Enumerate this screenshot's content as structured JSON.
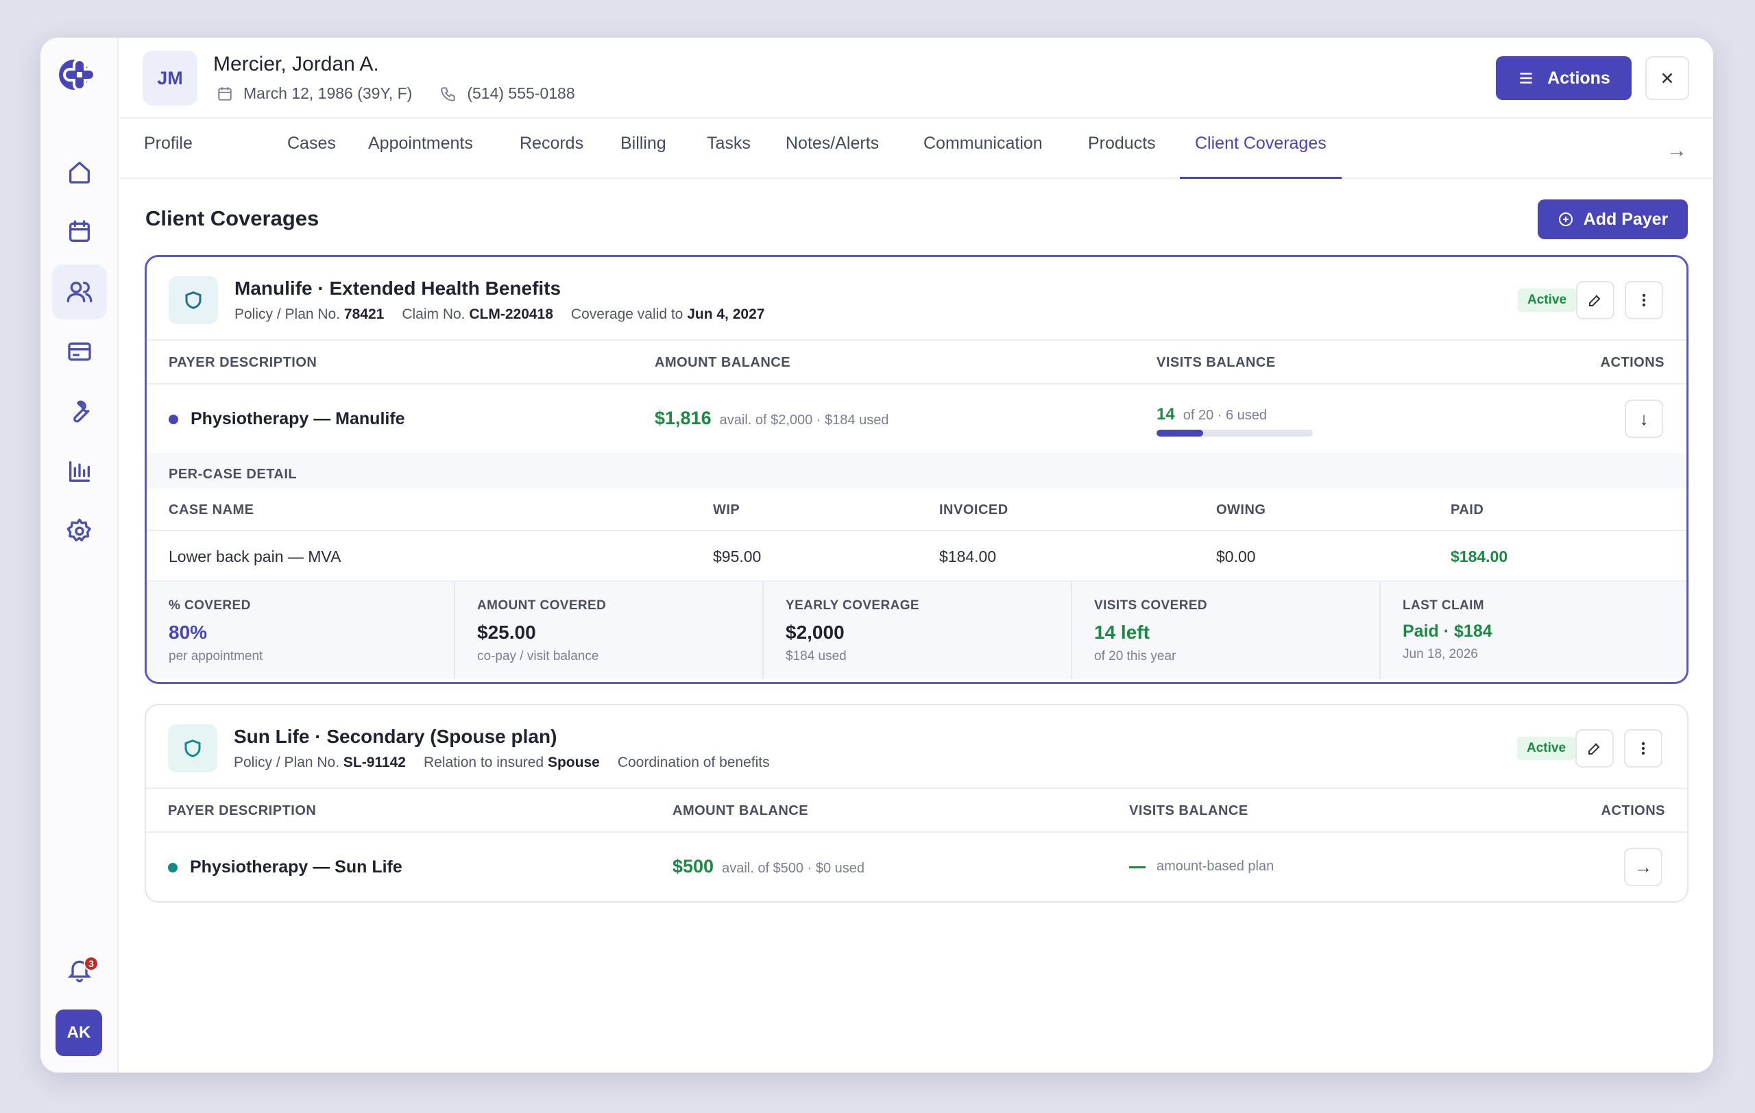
{
  "sidebar": {
    "items": [
      "home",
      "calendar",
      "clients",
      "billing",
      "tools",
      "reports",
      "settings"
    ],
    "notification_count": "3",
    "user_initials": "AK"
  },
  "header": {
    "initials": "JM",
    "name": "Mercier, Jordan A.",
    "dob": "March 12, 1986 (39Y, F)",
    "phone": "(514) 555-0188",
    "actions_label": "Actions"
  },
  "tabs": [
    "Profile",
    "Cases",
    "Appointments",
    "Records",
    "Billing",
    "Tasks",
    "Notes/Alerts",
    "Communication",
    "Products",
    "Client Coverages"
  ],
  "page": {
    "title": "Client Coverages",
    "add_payer_label": "Add Payer"
  },
  "coverages": [
    {
      "title": "Manulife · Extended Health Benefits",
      "policy_label": "Policy / Plan No.",
      "policy": "78421",
      "claim_label": "Claim No.",
      "claim": "CLM-220418",
      "valid_label": "Coverage valid to",
      "valid": "Jun 4, 2027",
      "status": "Active",
      "columns": [
        "PAYER DESCRIPTION",
        "AMOUNT BALANCE",
        "VISITS BALANCE",
        "ACTIONS"
      ],
      "row": {
        "desc": "Physiotherapy — Manulife",
        "amount": "$1,816",
        "amount_sub": "avail. of $2,000 · $184 used",
        "visits": "14",
        "visits_sub": "of 20 · 6 used",
        "visits_used_fraction": 0.3
      },
      "per_case_title": "PER-CASE DETAIL",
      "case_columns": [
        "CASE NAME",
        "WIP",
        "INVOICED",
        "OWING",
        "PAID"
      ],
      "case_row": [
        "Lower back pain — MVA",
        "$95.00",
        "$184.00",
        "$0.00",
        "$184.00"
      ],
      "stats": [
        {
          "label": "% COVERED",
          "value": "80%",
          "sub": "per appointment",
          "color": "#4845b8"
        },
        {
          "label": "AMOUNT COVERED",
          "value": "$25.00",
          "sub": "co-pay / visit balance",
          "color": "#1f2330"
        },
        {
          "label": "YEARLY COVERAGE",
          "value": "$2,000",
          "sub": "$184 used",
          "color": "#1f2330"
        },
        {
          "label": "VISITS COVERED",
          "value": "14 left",
          "sub": "of 20 this year",
          "color": "#1c8a42"
        },
        {
          "label": "LAST CLAIM",
          "value": "Paid · $184",
          "sub": "Jun 18, 2026",
          "color": "#1c8a42"
        }
      ]
    },
    {
      "title": "Sun Life · Secondary (Spouse plan)",
      "policy_label": "Policy / Plan No.",
      "policy": "SL-91142",
      "relation_label": "Relation to insured",
      "relation": "Spouse",
      "cob": "Coordination of benefits",
      "status": "Active",
      "columns": [
        "PAYER DESCRIPTION",
        "AMOUNT BALANCE",
        "VISITS BALANCE",
        "ACTIONS"
      ],
      "row": {
        "desc": "Physiotherapy — Sun Life",
        "amount": "$500",
        "amount_sub": "avail. of $500 · $0 used",
        "visits_sub": "amount-based plan"
      }
    }
  ],
  "colors": {
    "accent": "#4845b8",
    "success": "#1c8a42",
    "teal": "#0f8a8a"
  }
}
